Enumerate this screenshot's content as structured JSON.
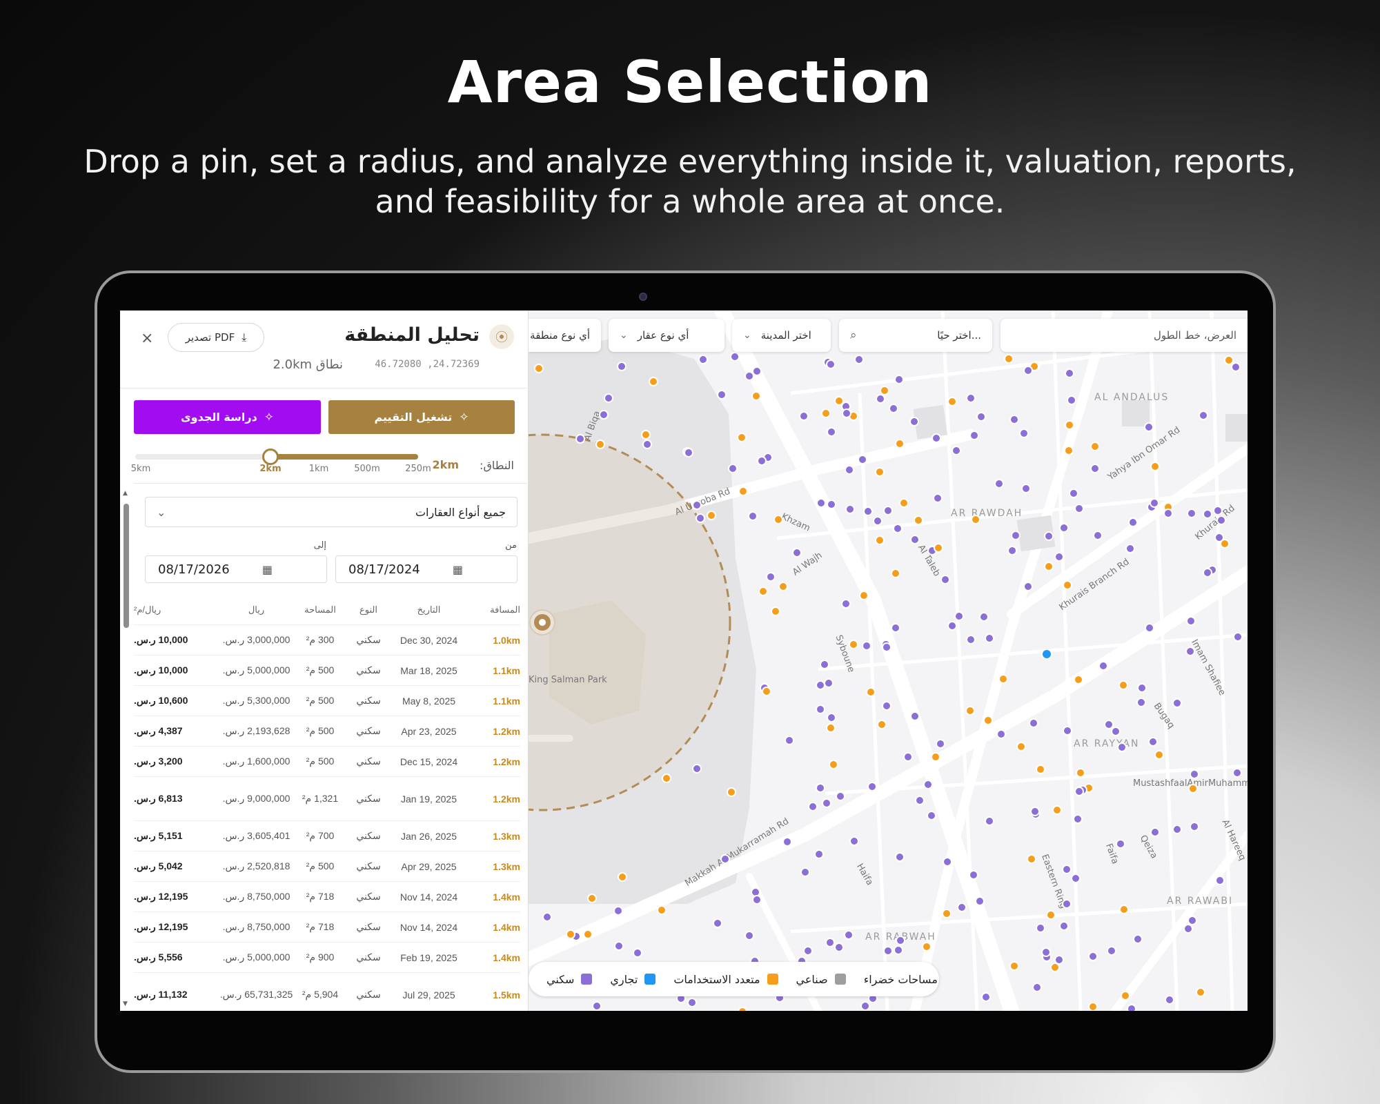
{
  "hero": {
    "title": "Area Selection",
    "subtitle": "Drop a pin, set a radius, and analyze everything inside it, valuation, reports, and feasibility for a whole area at once."
  },
  "panel": {
    "title": "تحليل المنطقة",
    "coords": "46.72080 ,24.72369",
    "radius_text": "نطاق 2.0km",
    "export_label": "تصدير PDF",
    "close_icon": "×",
    "valuation_button": "تشغيل التقييم",
    "feasibility_button": "دراسة الجدوى",
    "range_label": "النطاق:",
    "range_value": "2km",
    "range_ticks": [
      "250m",
      "500m",
      "1km",
      "2km",
      "5km"
    ],
    "range_selected": "2km",
    "property_type_select": "جميع أنواع العقارات",
    "from_label": "من",
    "to_label": "إلى",
    "from_date": "08/17/2024",
    "to_date": "08/17/2026"
  },
  "table": {
    "headers": {
      "distance": "المسافة",
      "date": "التاريخ",
      "type": "النوع",
      "area": "المساحة",
      "price": "ريال",
      "ppm": "ريال/م²"
    },
    "rows": [
      {
        "distance": "1.0km",
        "date": "Dec 30, 2024",
        "type": "سكني",
        "area": "300 م²",
        "price": "3,000,000 ر.س.",
        "ppm": "10,000 ر.س."
      },
      {
        "distance": "1.1km",
        "date": "Mar 18, 2025",
        "type": "سكني",
        "area": "500 م²",
        "price": "5,000,000 ر.س.",
        "ppm": "10,000 ر.س."
      },
      {
        "distance": "1.1km",
        "date": "May 8, 2025",
        "type": "سكني",
        "area": "500 م²",
        "price": "5,300,000 ر.س.",
        "ppm": "10,600 ر.س."
      },
      {
        "distance": "1.2km",
        "date": "Apr 23, 2025",
        "type": "سكني",
        "area": "500 م²",
        "price": "2,193,628 ر.س.",
        "ppm": "4,387 ر.س."
      },
      {
        "distance": "1.2km",
        "date": "Dec 15, 2024",
        "type": "سكني",
        "area": "500 م²",
        "price": "1,600,000 ر.س.",
        "ppm": "3,200 ر.س."
      },
      {
        "distance": "1.2km",
        "date": "Jan 19, 2025",
        "type": "سكني",
        "area": "1,321 م²",
        "price": "9,000,000 ر.س.",
        "ppm": "6,813 ر.س.",
        "tall": true
      },
      {
        "distance": "1.3km",
        "date": "Jan 26, 2025",
        "type": "سكني",
        "area": "700 م²",
        "price": "3,605,401 ر.س.",
        "ppm": "5,151 ر.س."
      },
      {
        "distance": "1.3km",
        "date": "Apr 29, 2025",
        "type": "سكني",
        "area": "500 م²",
        "price": "2,520,818 ر.س.",
        "ppm": "5,042 ر.س."
      },
      {
        "distance": "1.4km",
        "date": "Nov 14, 2024",
        "type": "سكني",
        "area": "718 م²",
        "price": "8,750,000 ر.س.",
        "ppm": "12,195 ر.س."
      },
      {
        "distance": "1.4km",
        "date": "Nov 14, 2024",
        "type": "سكني",
        "area": "718 م²",
        "price": "8,750,000 ر.س.",
        "ppm": "12,195 ر.س."
      },
      {
        "distance": "1.4km",
        "date": "Feb 19, 2025",
        "type": "سكني",
        "area": "900 م²",
        "price": "5,000,000 ر.س.",
        "ppm": "5,556 ر.س."
      },
      {
        "distance": "1.5km",
        "date": "Jul 29, 2025",
        "type": "سكني",
        "area": "5,904 م²",
        "price": "65,731,325 ر.س.",
        "ppm": "11,132 ر.س.",
        "tall": true
      }
    ]
  },
  "map": {
    "search_placeholder": "العرض، خط الطول",
    "search_value": "اختر حيًا...",
    "city_filter": "اختر المدينة",
    "property_type_filter": "أي نوع عقار",
    "zone_type_filter": "أي نوع منطقة",
    "districts": [
      "AL ANDALUS",
      "AR RAWDAH",
      "AR RAYYAN",
      "AR RAWABI",
      "AR RABWAH"
    ],
    "roads": [
      "Al Uaroba Rd",
      "Khurais Branch Rd",
      "Makkah Al Mukarramah Rd",
      "Eastern Ring",
      "Imam Shafiee",
      "Khurais Rd",
      "King Salman Park",
      "Al Biqa",
      "Al Taleb",
      "Khzam",
      "Al Wajh",
      "Syboune",
      "Bugaq",
      "Al Hareeq",
      "MustashfaalAmirMuhamm",
      "Faifa",
      "Haifa",
      "Qeiza",
      "Yahya Ibn Omar Rd"
    ],
    "legend": [
      {
        "label": "مساحات خضراء",
        "color": "#8bc34a"
      },
      {
        "label": "صناعي",
        "color": "#9e9e9e"
      },
      {
        "label": "متعدد الاستخدامات",
        "color": "#f59e1b"
      },
      {
        "label": "تجاري",
        "color": "#2196f3"
      },
      {
        "label": "سكني",
        "color": "#8b6fd6"
      }
    ],
    "colors": {
      "residential": "#8b6fd6",
      "mixed": "#f59e1b",
      "commercial": "#2196f3",
      "radius_stroke": "#b28b55"
    }
  }
}
